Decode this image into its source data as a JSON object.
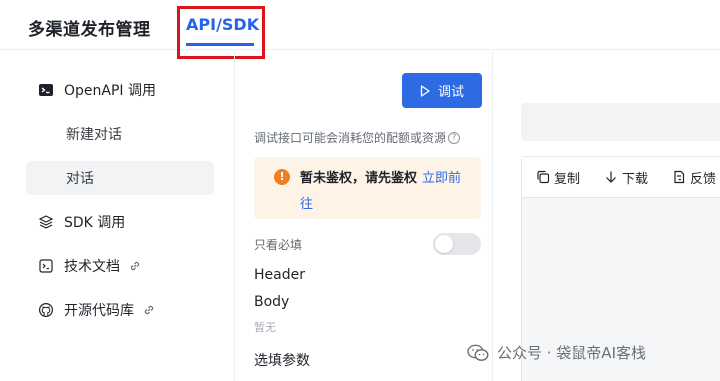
{
  "header": {
    "app_title": "多渠道发布管理",
    "active_tab": "API/SDK"
  },
  "sidebar": {
    "items": [
      {
        "label": "OpenAPI 调用",
        "icon": "terminal-icon"
      },
      {
        "label": "新建对话"
      },
      {
        "label": "对话",
        "active": true
      },
      {
        "label": "SDK 调用",
        "icon": "layers-icon"
      },
      {
        "label": "技术文档",
        "icon": "terminal-doc-icon",
        "link_icon": "link-icon"
      },
      {
        "label": "开源代码库",
        "icon": "github-icon",
        "link_icon": "link-icon"
      }
    ]
  },
  "middle": {
    "run_button": "调试",
    "notice": "调试接口可能会消耗您的配额或资源",
    "alert": {
      "message": "暂未鉴权，请先鉴权",
      "link_part1": "立即前",
      "link_part2": "往"
    },
    "toggle_label": "只看必填",
    "toggle_on": false,
    "sections": {
      "header": "Header",
      "body": "Body",
      "body_empty": "暂无",
      "optional": "选填参数"
    }
  },
  "right": {
    "toolbar": {
      "copy": "复制",
      "download": "下载",
      "feedback": "反馈"
    }
  },
  "watermark": {
    "text": "公众号 · 袋鼠帝AI客栈"
  },
  "colors": {
    "accent": "#2d6be4",
    "highlight_box": "#d9151b",
    "alert_bg": "#fdf3e6",
    "warn": "#f07f22"
  }
}
